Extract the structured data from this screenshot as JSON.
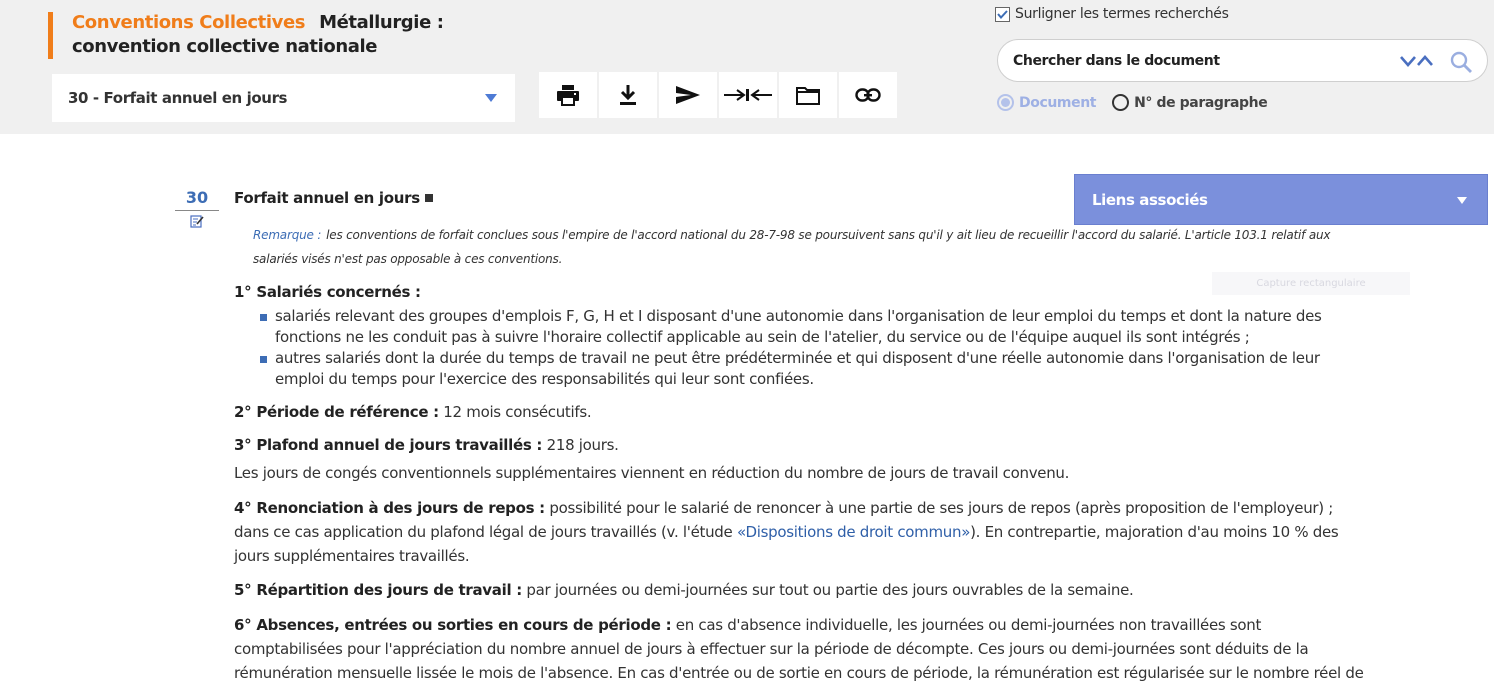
{
  "header": {
    "brand": "Conventions Collectives",
    "title": "Métallurgie : convention collective nationale",
    "accent_color": "#f07d1a"
  },
  "section_select": {
    "value": "30 - Forfait annuel en jours"
  },
  "toolbar": {
    "tools": [
      {
        "name": "print-icon"
      },
      {
        "name": "download-icon"
      },
      {
        "name": "send-icon"
      },
      {
        "name": "collapse-arrows-icon"
      },
      {
        "name": "folder-icon"
      },
      {
        "name": "link-icon"
      }
    ]
  },
  "highlight": {
    "checked": true,
    "label": "Surligner les termes recherchés"
  },
  "search": {
    "label": "Chercher dans le document"
  },
  "scope": {
    "options": [
      "Document",
      "N° de paragraphe"
    ],
    "selected": "Document"
  },
  "paragraph": {
    "number": "30",
    "title": "Forfait annuel en jours"
  },
  "remark": {
    "label": "Remarque :",
    "text": "les conventions de forfait conclues sous l'empire de l'accord national du 28-7-98 se poursuivent sans qu'il y ait lieu de recueillir l'accord du salarié. L'article 103.1 relatif aux salariés visés n'est pas opposable à ces conventions."
  },
  "sections": {
    "s1": {
      "num": "1°",
      "title": "Salariés concernés :",
      "bullets": [
        "salariés relevant des groupes d'emplois F, G, H et I disposant d'une autonomie dans l'organisation de leur emploi du temps et dont la nature des fonctions ne les conduit pas à suivre l'horaire collectif applicable au sein de l'atelier, du service ou de l'équipe auquel ils sont intégrés ;",
        "autres salariés dont la durée du temps de travail ne peut être prédéterminée et qui disposent d'une réelle autonomie dans l'organisation de leur emploi du temps pour l'exercice des responsabilités qui leur sont confiées."
      ]
    },
    "s2": {
      "num": "2°",
      "title": "Période de référence :",
      "text": "12 mois consécutifs."
    },
    "s3": {
      "num": "3°",
      "title": "Plafond annuel de jours travaillés :",
      "text": "218 jours.",
      "note": "Les jours de congés conventionnels supplémentaires viennent en réduction du nombre de jours de travail convenu."
    },
    "s4": {
      "num": "4°",
      "title": "Renonciation à des jours de repos :",
      "text_before": "possibilité pour le salarié de renoncer à une partie de ses jours de repos (après proposition de l'employeur) ; dans ce cas application du plafond légal de jours travaillés (v. l'étude",
      "link": "«Dispositions de droit commun»",
      "text_after": "). En contrepartie, majoration d'au moins 10 % des jours supplémentaires travaillés."
    },
    "s5": {
      "num": "5°",
      "title": "Répartition des jours de travail :",
      "text": "par journées ou demi-journées sur tout ou partie des jours ouvrables de la semaine."
    },
    "s6": {
      "num": "6°",
      "title": "Absences, entrées ou sorties en cours de période :",
      "text": "en cas d'absence individuelle, les journées ou demi-journées non travaillées sont comptabilisées pour l'appréciation du nombre annuel de jours à effectuer sur la période de décompte. Ces jours ou demi-journées sont déduits de la rémunération mensuelle lissée le mois de l'absence. En cas d'entrée ou de sortie en cours de période, la rémunération est régularisée sur le nombre réel de jours ou de demi-"
    }
  },
  "related": {
    "label": "Liens associés",
    "color": "#7b90dc"
  },
  "ghost_overlay": {
    "label": "Capture rectangulaire"
  }
}
